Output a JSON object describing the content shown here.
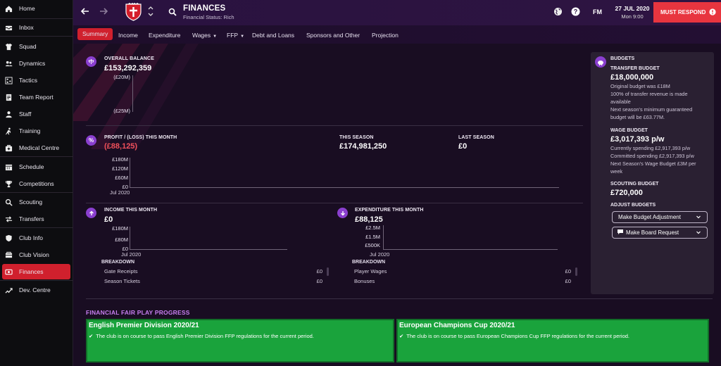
{
  "sidebar": {
    "items": [
      {
        "label": "Home",
        "icon": "home-icon"
      },
      {
        "label": "Inbox",
        "icon": "inbox-icon"
      },
      {
        "label": "Squad",
        "icon": "shirt-icon"
      },
      {
        "label": "Dynamics",
        "icon": "dynamics-icon"
      },
      {
        "label": "Tactics",
        "icon": "tactics-icon"
      },
      {
        "label": "Team Report",
        "icon": "report-icon"
      },
      {
        "label": "Staff",
        "icon": "staff-icon"
      },
      {
        "label": "Training",
        "icon": "training-icon"
      },
      {
        "label": "Medical Centre",
        "icon": "medical-icon"
      },
      {
        "label": "Schedule",
        "icon": "calendar-icon"
      },
      {
        "label": "Competitions",
        "icon": "trophy-icon"
      },
      {
        "label": "Scouting",
        "icon": "scouting-icon"
      },
      {
        "label": "Transfers",
        "icon": "transfers-icon"
      },
      {
        "label": "Club Info",
        "icon": "shield-icon"
      },
      {
        "label": "Club Vision",
        "icon": "vision-icon"
      },
      {
        "label": "Finances",
        "icon": "finances-icon"
      },
      {
        "label": "Dev. Centre",
        "icon": "dev-centre-icon"
      }
    ],
    "active": "Finances"
  },
  "header": {
    "title": "FINANCES",
    "subtitle": "Financial Status: Rich",
    "fm_label": "FM",
    "date": "27 JUL 2020",
    "time": "Mon 9:00",
    "must_respond": "MUST RESPOND"
  },
  "tabs": [
    {
      "label": "Summary",
      "dropdown": false
    },
    {
      "label": "Income",
      "dropdown": false
    },
    {
      "label": "Expenditure",
      "dropdown": false
    },
    {
      "label": "Wages",
      "dropdown": true
    },
    {
      "label": "FFP",
      "dropdown": true
    },
    {
      "label": "Debt and Loans",
      "dropdown": false
    },
    {
      "label": "Sponsors and Other",
      "dropdown": false
    },
    {
      "label": "Projection",
      "dropdown": false
    }
  ],
  "overall": {
    "label": "OVERALL BALANCE",
    "value": "£153,292,359",
    "ticks": [
      "(£20M)",
      "(£25M)"
    ]
  },
  "profit": {
    "label": "PROFIT / (LOSS) THIS MONTH",
    "value": "(£88,125)",
    "this_season_label": "THIS SEASON",
    "this_season_value": "£174,981,250",
    "last_season_label": "LAST SEASON",
    "last_season_value": "£0",
    "ticks": [
      "£180M",
      "£120M",
      "£60M",
      "£0"
    ],
    "xlabel": "Jul 2020"
  },
  "income": {
    "label": "INCOME THIS MONTH",
    "value": "£0",
    "ticks": [
      "£180M",
      "£80M",
      "£0"
    ],
    "xlabel": "Jul 2020",
    "breakdown_label": "BREAKDOWN",
    "rows": [
      {
        "name": "Gate Receipts",
        "value": "£0"
      },
      {
        "name": "Season Tickets",
        "value": "£0"
      }
    ]
  },
  "expenditure": {
    "label": "EXPENDITURE THIS MONTH",
    "value": "£88,125",
    "ticks": [
      "£2.5M",
      "£1.5M",
      "£500K"
    ],
    "xlabel": "Jul 2020",
    "breakdown_label": "BREAKDOWN",
    "rows": [
      {
        "name": "Player Wages",
        "value": "£0"
      },
      {
        "name": "Bonuses",
        "value": "£0"
      }
    ]
  },
  "budgets": {
    "title": "BUDGETS",
    "transfer_label": "TRANSFER BUDGET",
    "transfer_value": "£18,000,000",
    "transfer_notes": "Original budget was £18M\n100% of transfer revenue is made available\nNext season's minimum guaranteed budget will be £63.77M.",
    "wage_label": "WAGE BUDGET",
    "wage_value": "£3,017,393 p/w",
    "wage_notes": "Currently spending £2,917,393 p/w\nCommitted spending £2,917,393 p/w\nNext Season's Wage Budget £3M per week",
    "scouting_label": "SCOUTING BUDGET",
    "scouting_value": "£720,000",
    "adjust_label": "ADJUST BUDGETS",
    "btn_adjust": "Make Budget Adjustment",
    "btn_board": "Make Board Request"
  },
  "ffp": {
    "title": "FINANCIAL FAIR PLAY PROGRESS",
    "cards": [
      {
        "title": "English Premier Division 2020/21",
        "msg": "The club is on course to pass English Premier Division FFP regulations for the current period."
      },
      {
        "title": "European Champions Cup 2020/21",
        "msg": "The club is on course to pass European Champions Cup FFP regulations for the current period."
      }
    ]
  },
  "colors": {
    "accent": "#d0202d",
    "purple": "#8a3fcf",
    "ffp_green": "#1aa33c",
    "negative": "#f0505a"
  }
}
